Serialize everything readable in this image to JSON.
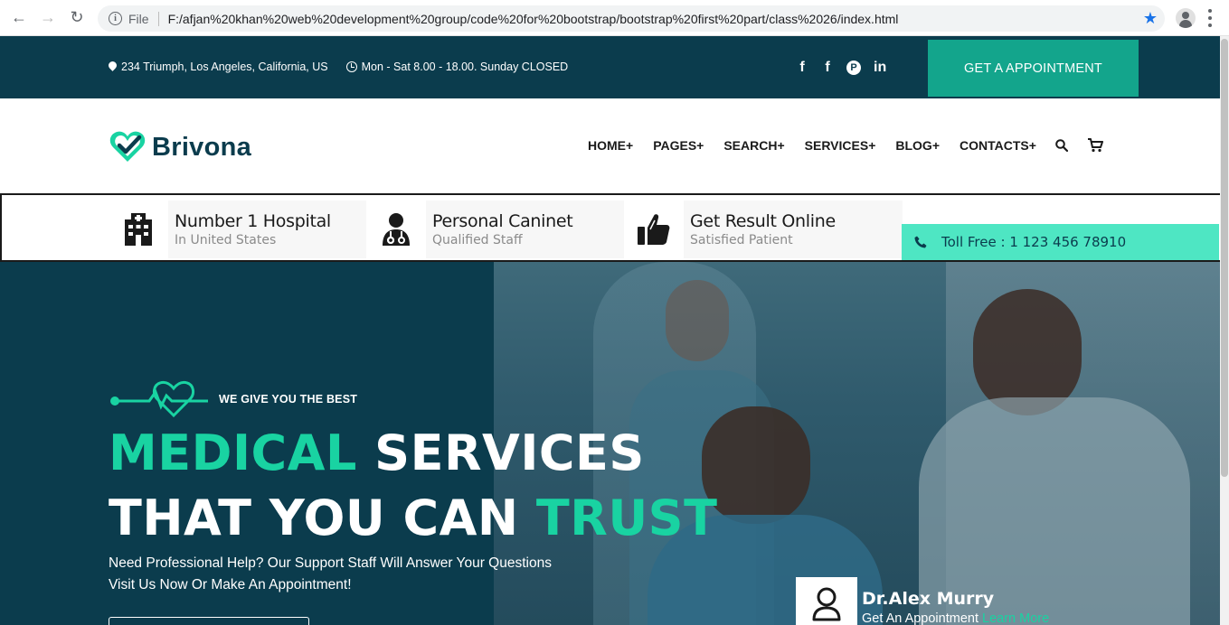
{
  "browser": {
    "file_label": "File",
    "url": "F:/afjan%20khan%20web%20development%20group/code%20for%20bootstrap/bootstrap%20first%20part/class%2026/index.html"
  },
  "topbar": {
    "address": "234 Triumph, Los Angeles, California, US",
    "hours": "Mon - Sat 8.00 - 18.00. Sunday CLOSED",
    "social": [
      "f",
      "f",
      "P",
      "in"
    ],
    "appointment_button": "GET A APPOINTMENT"
  },
  "navbar": {
    "brand": "Brivona",
    "links": [
      "HOME+",
      "PAGES+",
      "SEARCH+",
      "SERVICES+",
      "BLOG+",
      "CONTACTS+"
    ]
  },
  "features": [
    {
      "title": "Number 1 Hospital",
      "subtitle": "In United States",
      "icon": "hospital-icon"
    },
    {
      "title": "Personal Caninet",
      "subtitle": "Qualified Staff",
      "icon": "doctor-icon"
    },
    {
      "title": "Get Result Online",
      "subtitle": "Satisfied Patient",
      "icon": "thumbs-up-icon"
    }
  ],
  "tollfree": "Toll Free : 1 123 456 78910",
  "hero": {
    "tagline": "WE GIVE YOU THE BEST",
    "line1_accent": "MEDICAL",
    "line1_rest": " SERVICES",
    "line2_main": "THAT YOU CAN ",
    "line2_accent": "TRUST",
    "para1": "Need Professional Help? Our Support Staff Will Answer Your Questions",
    "para2": "Visit Us Now Or Make An Appointment!"
  },
  "doctor": {
    "name": "Dr.Alex Murry",
    "sub": "Get An Appointment ",
    "link": "Learn More"
  },
  "colors": {
    "dark_teal": "#0b3c4d",
    "accent_green": "#19d3a2",
    "button_green": "#13a58c",
    "tollfree_bg": "#4ee6c3"
  }
}
